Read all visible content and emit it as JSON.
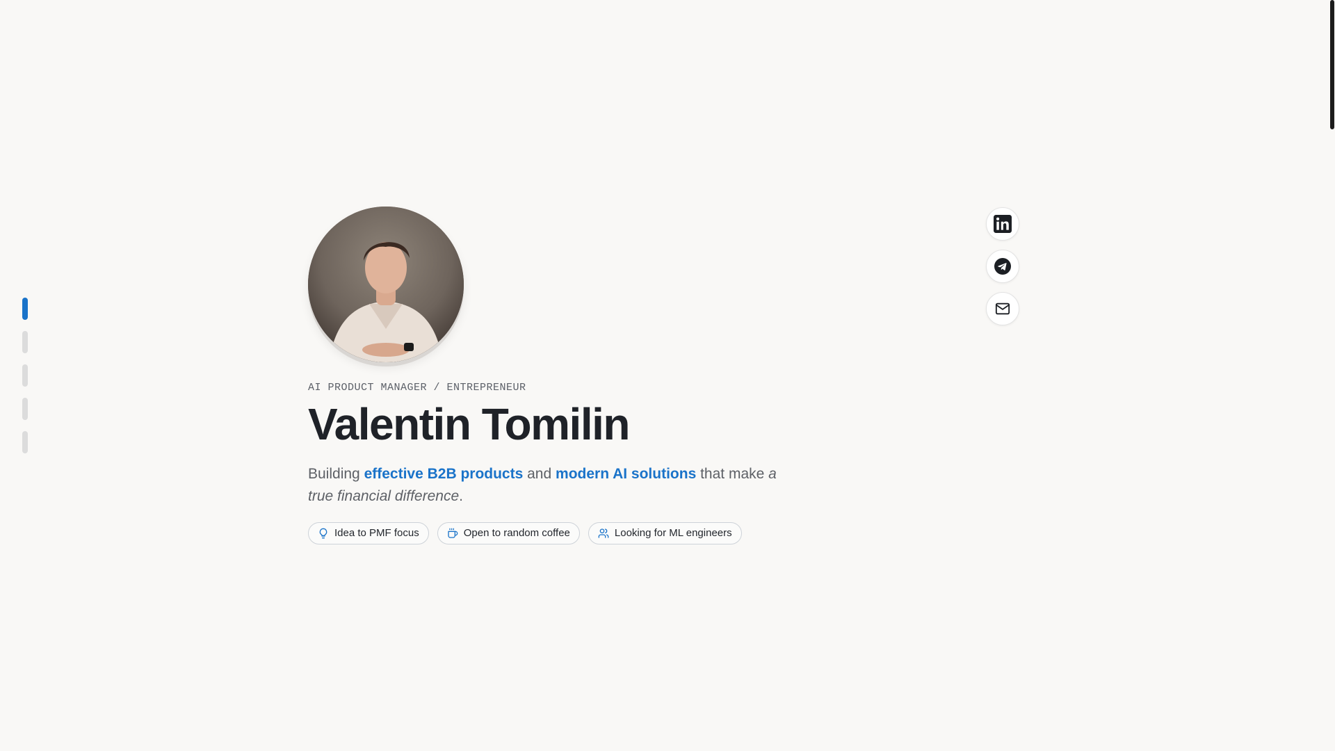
{
  "section_nav": {
    "items": [
      {
        "active": true
      },
      {
        "active": false
      },
      {
        "active": false
      },
      {
        "active": false
      },
      {
        "active": false
      }
    ]
  },
  "hero": {
    "eyebrow": "AI PRODUCT MANAGER / ENTREPRENEUR",
    "name": "Valentin Tomilin",
    "tagline": {
      "prefix": "Building ",
      "highlight_1": "effective B2B products",
      "middle": " and ",
      "highlight_2": "modern AI solutions",
      "suffix": " that make ",
      "emphasis": "a true financial difference",
      "end": "."
    },
    "chips": [
      {
        "label": "Idea to PMF focus",
        "icon": "lightbulb-icon"
      },
      {
        "label": "Open to random coffee",
        "icon": "coffee-icon"
      },
      {
        "label": "Looking for ML engineers",
        "icon": "users-icon"
      }
    ]
  },
  "socials": [
    {
      "icon": "linkedin-icon"
    },
    {
      "icon": "telegram-icon"
    },
    {
      "icon": "mail-icon"
    }
  ],
  "colors": {
    "accent": "#1a73c9",
    "background": "#f9f8f6",
    "text": "#1f2228",
    "muted": "#5d6066"
  }
}
